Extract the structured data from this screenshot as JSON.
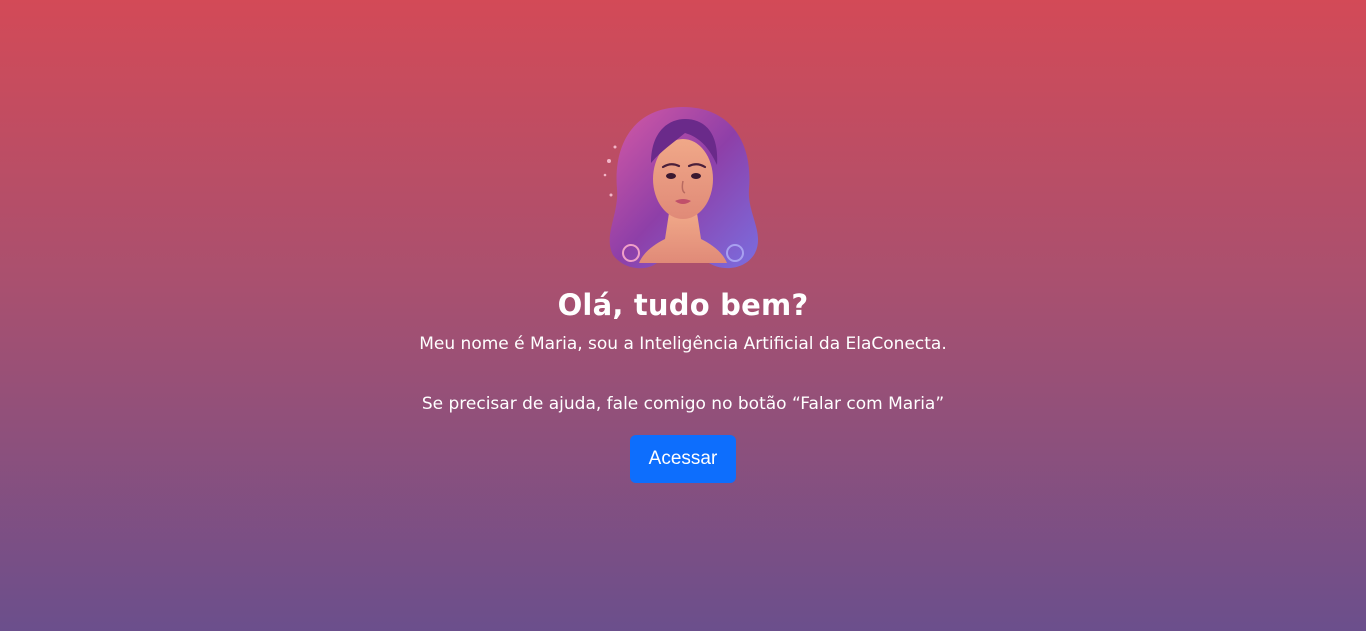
{
  "welcome": {
    "avatar_icon": "woman-avatar-icon",
    "title": "Olá, tudo bem?",
    "intro": "Meu nome é Maria, sou a Inteligência Artificial da ElaConecta.",
    "help": "Se precisar de ajuda, fale comigo no botão “Falar com Maria”",
    "access_button_label": "Acessar"
  },
  "colors": {
    "background_top": "#d34a57",
    "background_bottom": "#6b4f8c",
    "button": "#0d6efd",
    "text": "#ffffff"
  }
}
